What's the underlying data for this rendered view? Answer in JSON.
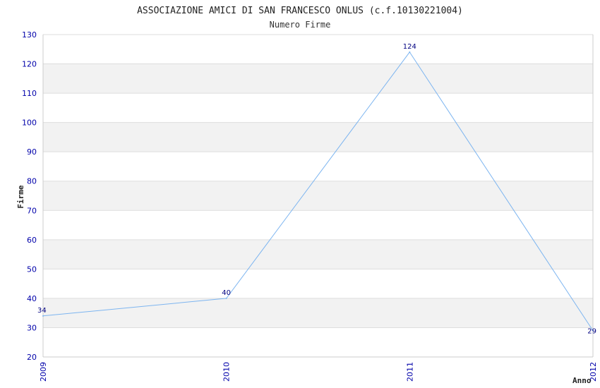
{
  "colors": {
    "band": "#f2f2f2",
    "plot_bg": "#ffffff",
    "grid": "#dddddd",
    "axis": "#cccccc",
    "line": "#7db5f0",
    "tick_text": "#0000aa",
    "data_label": "#000080"
  },
  "chart_data": {
    "type": "line",
    "title": "ASSOCIAZIONE AMICI DI SAN FRANCESCO ONLUS (c.f.10130221004)",
    "subtitle": "Numero Firme",
    "xlabel": "Anno",
    "ylabel": "Firme",
    "categories": [
      "2009",
      "2010",
      "2011",
      "2012"
    ],
    "series": [
      {
        "values": [
          34,
          40,
          124,
          29
        ]
      }
    ],
    "ylim": [
      20,
      130
    ],
    "yticks": [
      20,
      30,
      40,
      50,
      60,
      70,
      80,
      90,
      100,
      110,
      120,
      130
    ],
    "grid": true,
    "legend": "none"
  }
}
